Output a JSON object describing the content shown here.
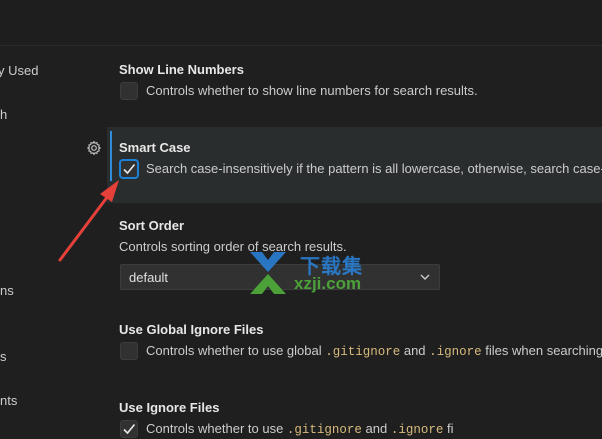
{
  "sidebar": {
    "items": [
      {
        "label": "y Used"
      },
      {
        "label": "h"
      },
      {
        "label": "ns"
      },
      {
        "label": "s"
      },
      {
        "label": "nts"
      }
    ]
  },
  "settings": {
    "show_line_numbers": {
      "title": "Show Line Numbers",
      "desc": "Controls whether to show line numbers for search results.",
      "checked": false
    },
    "smart_case": {
      "title": "Smart Case",
      "desc": "Search case-insensitively if the pattern is all lowercase, otherwise, search case-se",
      "checked": true
    },
    "sort_order": {
      "title": "Sort Order",
      "desc": "Controls sorting order of search results.",
      "value": "default"
    },
    "use_global_ignore": {
      "title": "Use Global Ignore Files",
      "desc_pre": "Controls whether to use global ",
      "code1": ".gitignore",
      "desc_mid": " and ",
      "code2": ".ignore",
      "desc_post": " files when searching f",
      "checked": false
    },
    "use_ignore": {
      "title": "Use Ignore Files",
      "desc_pre": "Controls whether to use ",
      "code1": ".gitignore",
      "desc_mid": " and ",
      "code2": ".ignore",
      "desc_post": " fi",
      "checked": true
    }
  },
  "watermark": {
    "cn": "下载集",
    "en": "xzji.com"
  },
  "colors": {
    "accent": "#2f8ad8",
    "annotation_arrow": "#e5403a"
  }
}
